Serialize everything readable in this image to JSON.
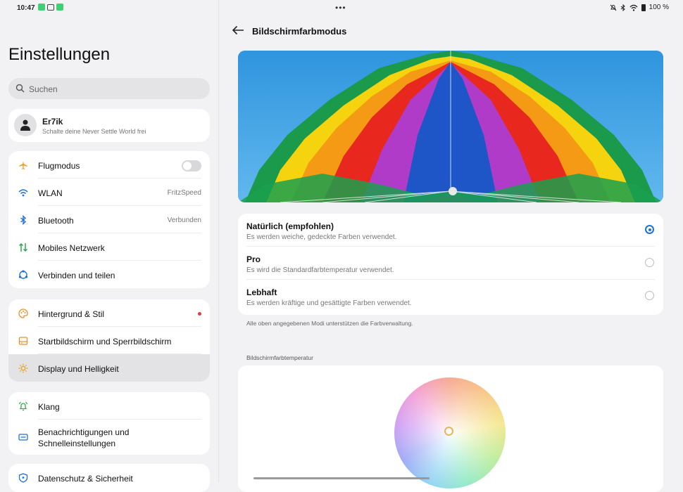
{
  "status": {
    "time": "10:47",
    "battery": "100 %"
  },
  "sidebar": {
    "title": "Einstellungen",
    "search_placeholder": "Suchen",
    "profile": {
      "name": "Er7ik",
      "subtitle": "Schalte deine Never Settle World frei"
    },
    "group1": [
      {
        "label": "Flugmodus",
        "value": "",
        "toggle": false
      },
      {
        "label": "WLAN",
        "value": "FritzSpeed"
      },
      {
        "label": "Bluetooth",
        "value": "Verbunden"
      },
      {
        "label": "Mobiles Netzwerk",
        "value": ""
      },
      {
        "label": "Verbinden und teilen",
        "value": ""
      }
    ],
    "group2": [
      {
        "label": "Hintergrund & Stil"
      },
      {
        "label": "Startbildschirm und Sperrbildschirm"
      },
      {
        "label": "Display und Helligkeit",
        "selected": true
      }
    ],
    "group3": [
      {
        "label": "Klang"
      },
      {
        "label": "Benachrichtigungen und Schnelleinstellungen"
      }
    ],
    "group4": [
      {
        "label": "Datenschutz & Sicherheit"
      }
    ]
  },
  "page": {
    "title": "Bildschirmfarbmodus",
    "options": [
      {
        "title": "Natürlich (empfohlen)",
        "desc": "Es werden weiche, gedeckte Farben verwendet.",
        "checked": true
      },
      {
        "title": "Pro",
        "desc": "Es wird die Standardfarbtemperatur verwendet.",
        "checked": false
      },
      {
        "title": "Lebhaft",
        "desc": "Es werden kräftige und gesättigte Farben verwendet.",
        "checked": false
      }
    ],
    "note": "Alle oben angegebenen Modi unterstützen die Farbverwaltung.",
    "temp_section": "Bildschirmfarbtemperatur"
  },
  "colors": {
    "accent": "#1f6fe0",
    "toggle_off": "#d8d8dc",
    "badge": "#e23b3b"
  }
}
